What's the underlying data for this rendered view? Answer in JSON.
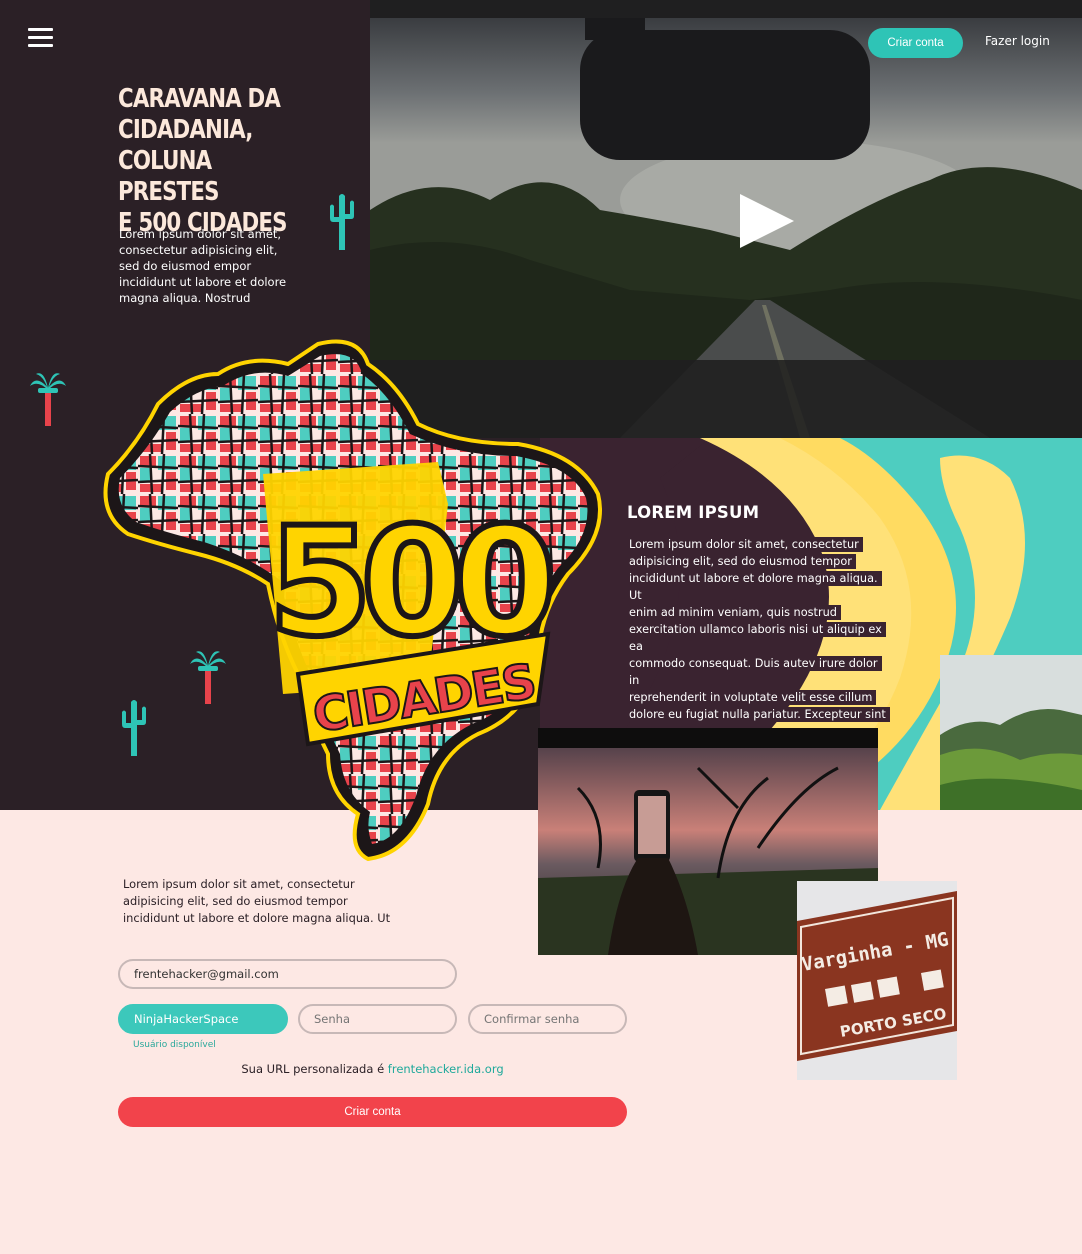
{
  "nav": {
    "create_account": "Criar conta",
    "login": "Fazer login"
  },
  "hero": {
    "title_lines": [
      "CARAVANA DA",
      "CIDADANIA,",
      "COLUNA PRESTES",
      "E 500 CIDADES"
    ],
    "intro_lines": [
      "Lorem ipsum dolor sit amet,",
      "consectetur adipisicing elit,",
      "sed do eiusmod empor",
      "incididunt ut labore et dolore",
      "magna aliqua. Nostrud"
    ]
  },
  "logo": {
    "number": "500",
    "word": "CIDADES"
  },
  "section": {
    "title": "LOREM IPSUM",
    "body_lines": [
      "Lorem ipsum dolor sit amet, consectetur",
      "adipisicing elit, sed do eiusmod tempor",
      "incididunt ut labore et dolore magna aliqua. Ut",
      "enim ad minim veniam, quis nostrud",
      "exercitation ullamco laboris nisi ut aliquip ex ea",
      "commodo consequat. Duis autev irure dolor in",
      "reprehenderit in voluptate velit esse cillum",
      "dolore eu fugiat nulla pariatur. Excepteur sint"
    ]
  },
  "photos": {
    "sign_line1": "Varginha - MG",
    "sign_line2": "PORTO SECO"
  },
  "form": {
    "text_lines": [
      "Lorem ipsum dolor sit amet, consectetur",
      "adipisicing elit, sed do eiusmod tempor",
      "incididunt ut labore et dolore magna aliqua. Ut"
    ],
    "email_value": "frentehacker@gmail.com",
    "username_value": "NinjaHackerSpace",
    "password_placeholder": "Senha",
    "confirm_placeholder": "Confirmar senha",
    "username_status": "Usuário disponível",
    "url_prefix": "Sua URL personalizada é ",
    "url_link": "frentehacker.ida.org",
    "submit": "Criar conta"
  },
  "colors": {
    "dark": "#2b2026",
    "teal": "#2ec4b6",
    "yellow": "#ffd400",
    "red": "#f2434b",
    "cream": "#fde8e4"
  }
}
